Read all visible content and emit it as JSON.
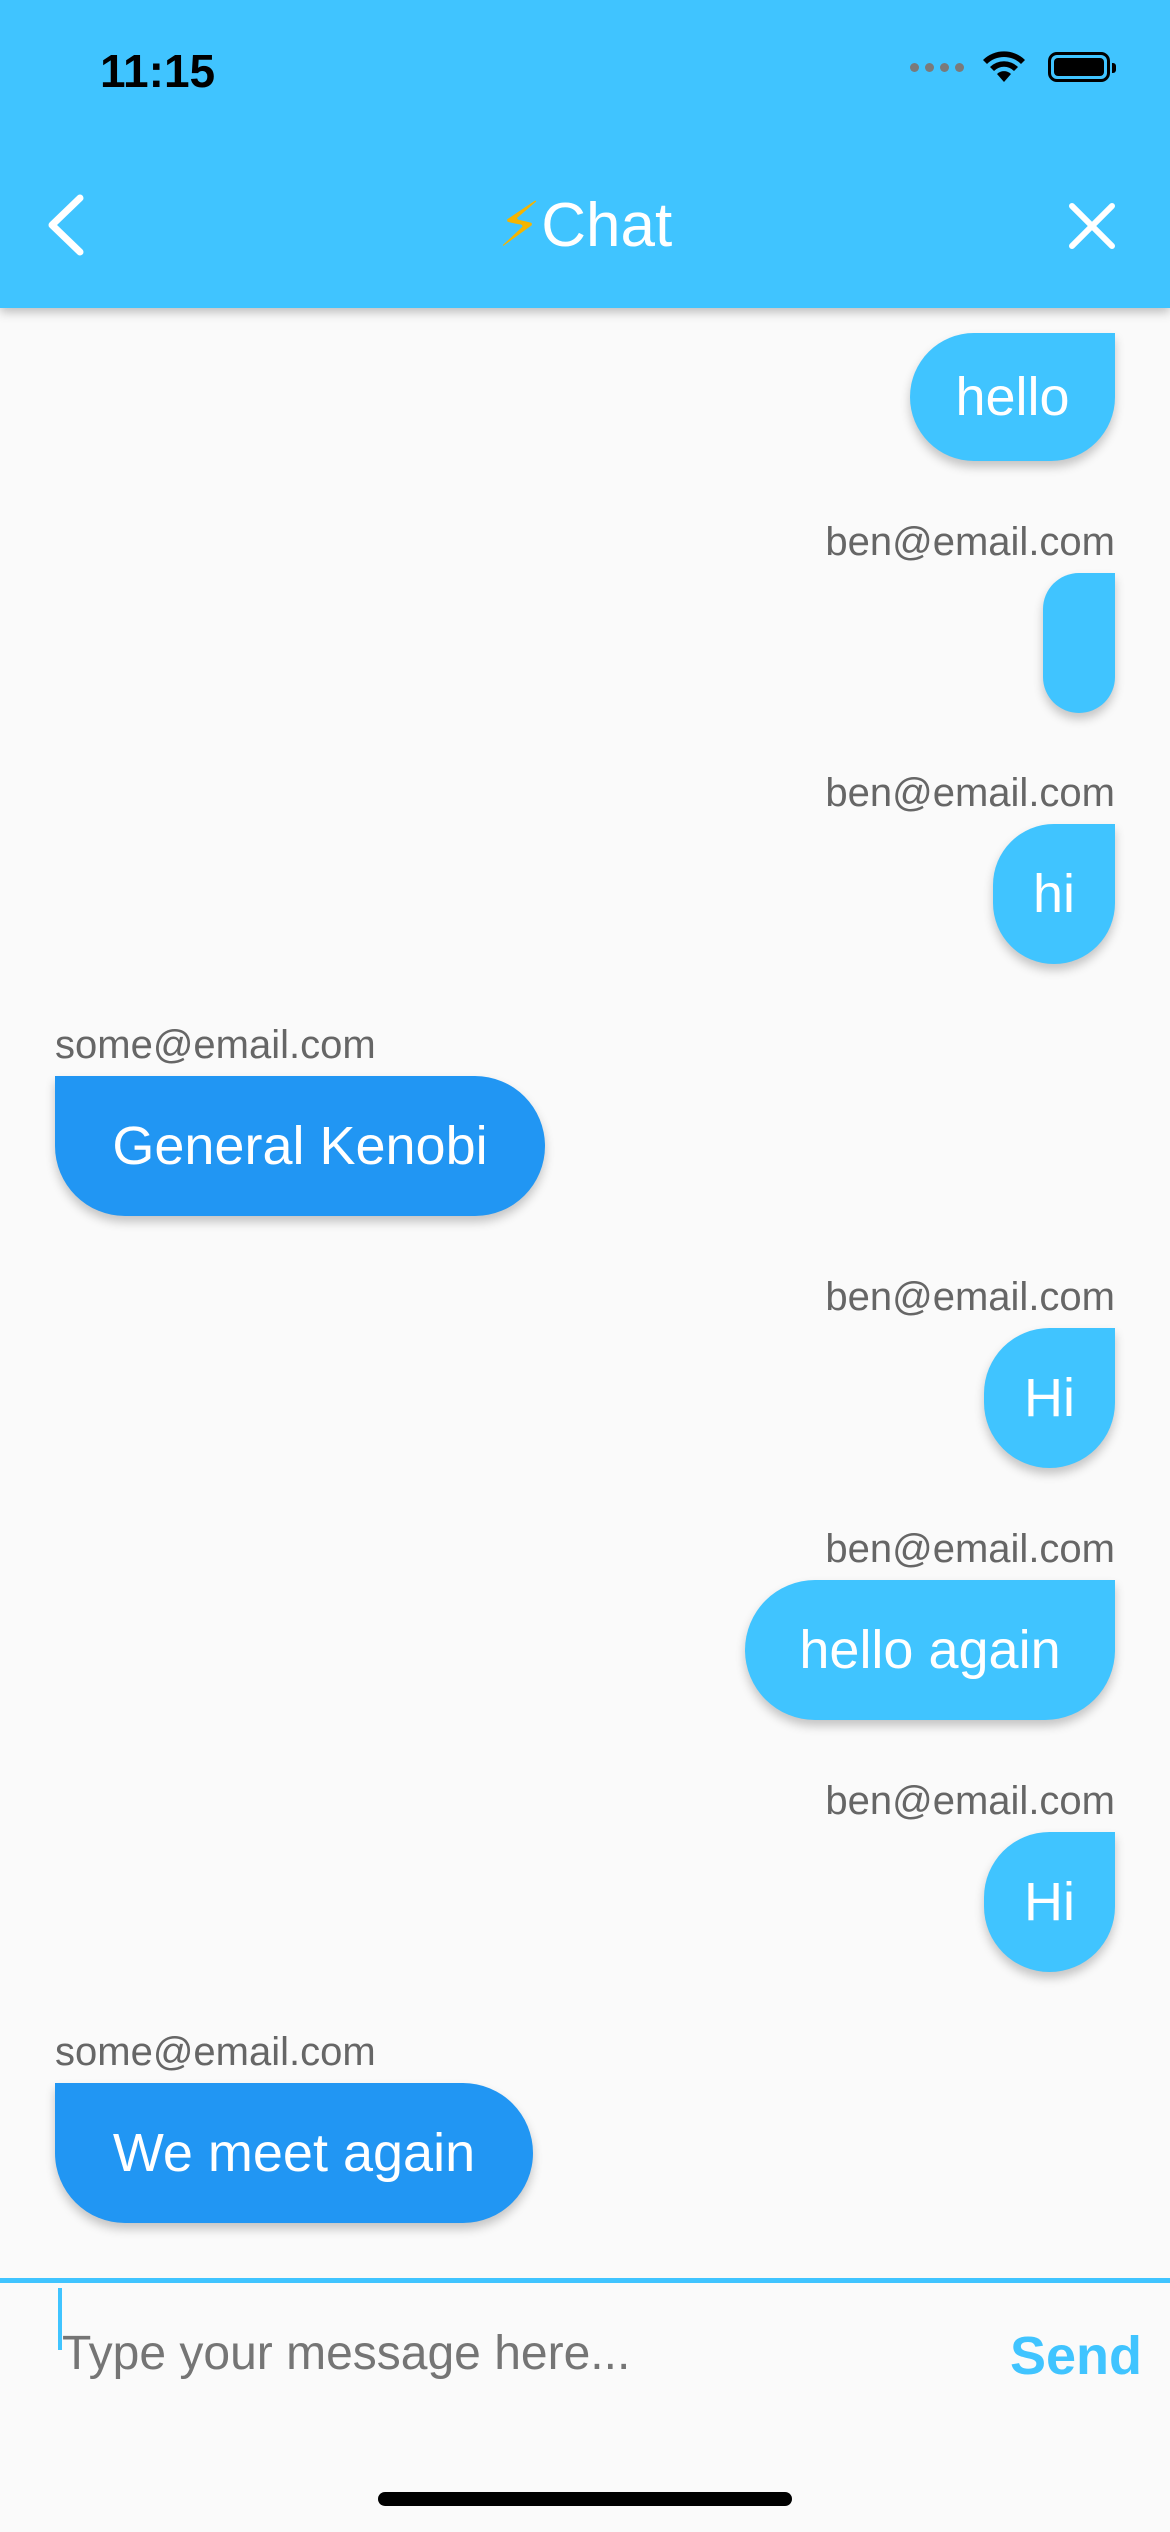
{
  "status_bar": {
    "time": "11:15"
  },
  "header": {
    "title_icon": "⚡",
    "title": "Chat",
    "back_icon": "chevron-left-icon",
    "close_icon": "close-icon"
  },
  "messages": [
    {
      "sender": "",
      "text": "hello",
      "mine": true
    },
    {
      "sender": "ben@email.com",
      "text": "",
      "mine": true
    },
    {
      "sender": "ben@email.com",
      "text": "hi",
      "mine": true
    },
    {
      "sender": "some@email.com",
      "text": "General Kenobi",
      "mine": false
    },
    {
      "sender": "ben@email.com",
      "text": "Hi",
      "mine": true
    },
    {
      "sender": "ben@email.com",
      "text": "hello again",
      "mine": true
    },
    {
      "sender": "ben@email.com",
      "text": "Hi",
      "mine": true
    },
    {
      "sender": "some@email.com",
      "text": "We meet again",
      "mine": false
    }
  ],
  "composer": {
    "placeholder": "Type your message here...",
    "send_label": "Send"
  },
  "colors": {
    "accent": "#40c4ff",
    "other_bubble": "#2196f3",
    "background": "#fafafa"
  }
}
